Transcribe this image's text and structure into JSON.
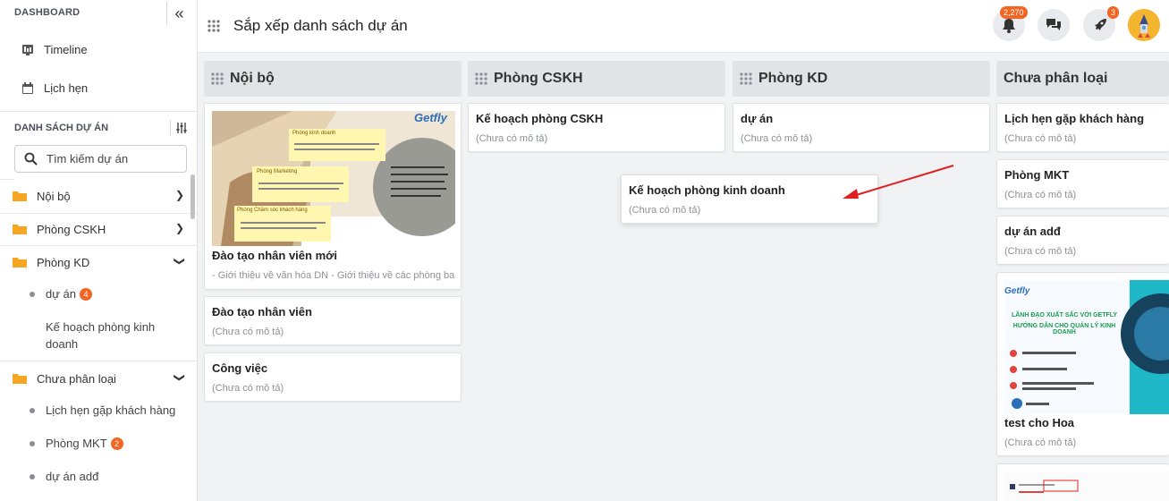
{
  "sidebar": {
    "header": "DASHBOARD",
    "nav": [
      {
        "label": "Timeline"
      },
      {
        "label": "Lịch hẹn"
      }
    ],
    "section_title": "DANH SÁCH DỰ ÁN",
    "search_placeholder": "Tìm kiếm dự án",
    "folders": [
      {
        "label": "Nội bộ"
      },
      {
        "label": "Phòng CSKH"
      },
      {
        "label": "Phòng KD"
      },
      {
        "label": "Chưa phân loại"
      }
    ],
    "phong_kd_items": [
      {
        "label": "dự án",
        "badge": "4"
      },
      {
        "label": "Kế hoạch phòng kinh doanh"
      }
    ],
    "chua_phan_loai_items": [
      {
        "label": "Lịch hẹn gặp khách hàng"
      },
      {
        "label": "Phòng MKT",
        "badge": "2"
      },
      {
        "label": "dự án adđ"
      }
    ]
  },
  "header": {
    "title": "Sắp xếp danh sách dự án",
    "notification_count": "2,270",
    "rocket_count": "3"
  },
  "board": {
    "columns": [
      {
        "title": "Nội bộ",
        "cards": [
          {
            "title": "Đào tạo nhân viên mới",
            "desc": "- Giới thiệu về văn hóa DN - Giới thiệu về các phòng ban..."
          },
          {
            "title": "Đào tạo nhân viên",
            "desc": "(Chưa có mô tả)"
          },
          {
            "title": "Công việc",
            "desc": "(Chưa có mô tả)"
          }
        ],
        "thumbnail": {
          "brand": "Getfly",
          "note1_title": "Phòng kinh doanh",
          "note2_title": "Phòng Marketing",
          "note3_title": "Phòng Chăm sóc khách hàng"
        }
      },
      {
        "title": "Phòng CSKH",
        "cards": [
          {
            "title": "Kế hoạch phòng CSKH",
            "desc": "(Chưa có mô tả)"
          }
        ]
      },
      {
        "title": "Phòng KD",
        "cards": [
          {
            "title": "dự án",
            "desc": "(Chưa có mô tả)"
          }
        ],
        "dragging_card": {
          "title": "Kế hoạch phòng kinh doanh",
          "desc": "(Chưa có mô tả)"
        }
      },
      {
        "title": "Chưa phân loại",
        "cards": [
          {
            "title": "Lịch hẹn gặp khách hàng",
            "desc": "(Chưa có mô tả)"
          },
          {
            "title": "Phòng MKT",
            "desc": "(Chưa có mô tả)"
          },
          {
            "title": "dự án adđ",
            "desc": "(Chưa có mô tả)"
          },
          {
            "title": "test cho Hoa",
            "desc": "(Chưa có mô tả)"
          }
        ],
        "banner": {
          "brand": "Getfly",
          "headline": "LÃNH ĐẠO XUẤT SẮC VỚI GETFLY",
          "subline": "HƯỚNG DẪN CHO QUẢN LÝ KINH DOANH"
        }
      }
    ]
  },
  "colors": {
    "accent": "#f26522",
    "arrow": "#e02020",
    "banner": "#1fb8c9"
  }
}
